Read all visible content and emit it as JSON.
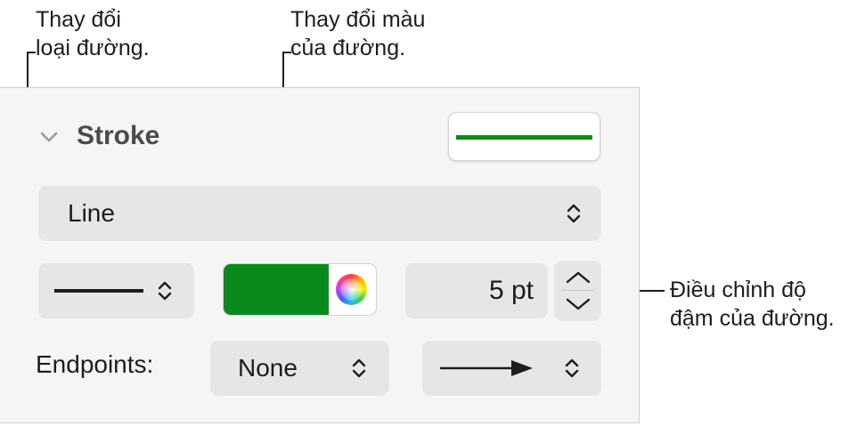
{
  "callouts": {
    "line_type": [
      "Thay đổi",
      "loại đường."
    ],
    "line_color": [
      "Thay đổi màu",
      "của đường."
    ],
    "line_weight": [
      "Điều chỉnh độ",
      "đậm của đường."
    ]
  },
  "stroke": {
    "section_title": "Stroke",
    "line_style_value": "Line",
    "stroke_color": "#0a8a1c",
    "width_value": "5 pt"
  },
  "endpoints": {
    "label": "Endpoints:",
    "start_value": "None"
  },
  "colors": {
    "panel_bg": "#f5f5f5",
    "control_bg": "#e6e6e6",
    "accent_green": "#0a8a1c"
  },
  "icons": [
    "chevron-down-icon",
    "updown-chevron-icon",
    "color-wheel-icon",
    "arrow-right-icon",
    "stepper-up-icon",
    "stepper-down-icon"
  ]
}
